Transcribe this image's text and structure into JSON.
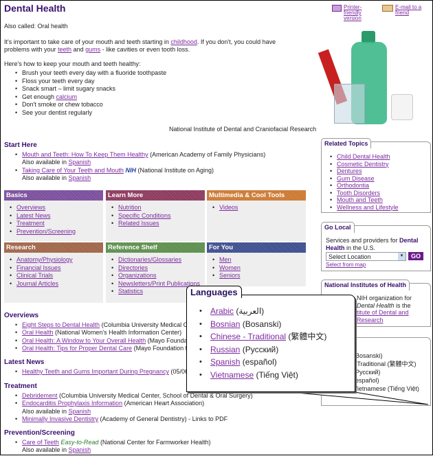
{
  "title": "Dental Health",
  "also_called": "Also called: Oral health",
  "intro": {
    "p1": "It's important to take care of your mouth and teeth starting in ",
    "l1": "childhood",
    "p2": ". If you don't, you could have problems with your ",
    "l2": "teeth",
    "p3": " and ",
    "l3": "gums",
    "p4": " - like cavities or even tooth loss."
  },
  "howto": "Here's how to keep your mouth and teeth healthy:",
  "tips": [
    "Brush your teeth every day with a fluoride toothpaste",
    "Floss your teeth every day",
    "Snack smart – limit sugary snacks",
    "Get enough ",
    "Don't smoke or chew tobacco",
    "See your dentist regularly"
  ],
  "tip_link": "calcium",
  "attribution": "National Institute of Dental and Craniofacial Research",
  "tools": {
    "print": "Printer-friendly version",
    "email": "E-mail to a friend"
  },
  "start_here": {
    "title": "Start Here",
    "items": [
      {
        "link": "Mouth and Teeth: How To Keep Them Healthy",
        "source": "(American Academy of Family Physicians)"
      },
      {
        "link": "Taking Care of Your Teeth and Mouth",
        "badge": "NIH",
        "source": "(National Institute on Aging)"
      }
    ],
    "also": "Also available in ",
    "spanish": "Spanish"
  },
  "boxes": [
    {
      "title": "Basics",
      "color": "#7b4f9d",
      "items": [
        "Overviews",
        "Latest News",
        "Treatment",
        "Prevention/Screening"
      ]
    },
    {
      "title": "Learn More",
      "color": "#8d3a5e",
      "items": [
        "Nutrition",
        "Specific Conditions",
        "Related Issues"
      ]
    },
    {
      "title": "Multimedia & Cool Tools",
      "color": "#cc7a33",
      "items": [
        "Videos"
      ]
    },
    {
      "title": "Research",
      "color": "#a0664a",
      "items": [
        "Anatomy/Physiology",
        "Financial Issues",
        "Clinical Trials",
        "Journal Articles"
      ]
    },
    {
      "title": "Reference Shelf",
      "color": "#5e8f4e",
      "items": [
        "Dictionaries/Glossaries",
        "Directories",
        "Organizations",
        "Newsletters/Print Publications",
        "Statistics"
      ]
    },
    {
      "title": "For You",
      "color": "#3f4f8f",
      "items": [
        "Men",
        "Women",
        "Seniors"
      ]
    }
  ],
  "overviews": {
    "title": "Overviews",
    "items": [
      {
        "link": "Eight Steps to Dental Health",
        "source": "(Columbia University Medical Center"
      },
      {
        "link": "Oral Health",
        "source": "(National Women's Health Information Center)"
      },
      {
        "link": "Oral Health: A Window to Your Overall Health",
        "source": "(Mayo Foundation fo"
      },
      {
        "link": "Oral Health: Tips for Proper Dental Care",
        "source": "(Mayo Foundation for Me"
      }
    ]
  },
  "latest_news": {
    "title": "Latest News",
    "items": [
      {
        "link": "Healthy Teeth and Gums Important During Pregnancy",
        "source": "(05/06/2008"
      }
    ]
  },
  "treatment": {
    "title": "Treatment",
    "items": [
      {
        "link": "Debridement",
        "source": "(Columbia University Medical Center, School of Dental & Oral Surgery)"
      },
      {
        "link": "Endocarditis Prophylaxis Information",
        "source": "(American Heart Association)"
      },
      {
        "link": "Minimally Invasive Dentistry",
        "source": "(Academy of General Dentistry) - Links to PDF"
      }
    ]
  },
  "prevention": {
    "title": "Prevention/Screening",
    "items": [
      {
        "link": "Care of Teeth",
        "tag": "Easy-to-Read",
        "source": "(National Center for Farmworker Health)"
      }
    ]
  },
  "related": {
    "title": "Related Topics",
    "items": [
      "Child Dental Health",
      "Cosmetic Dentistry",
      "Dentures",
      "Gum Disease",
      "Orthodontia",
      "Tooth Disorders",
      "Mouth and Teeth",
      "Wellness and Lifestyle"
    ]
  },
  "go_local": {
    "title": "Go Local",
    "t1": "Services and providers for ",
    "b": "Dental Health",
    "t2": " in the U.S.",
    "select": "Select Location",
    "go": "GO",
    "map": "Select from map"
  },
  "nih": {
    "title": "National Institutes of Health",
    "t1": "NIH organization for",
    "t2": "Dental Health",
    "t3": " is the",
    "l": "titute of Dental and",
    "l2": "Research"
  },
  "languages": {
    "title": "Languages",
    "items": [
      {
        "link": "Arabic",
        "native": "(العربية)"
      },
      {
        "link": "Bosnian",
        "native": "(Bosanski)"
      },
      {
        "link": "Chinese - Traditional",
        "native": "(繁體中文)"
      },
      {
        "link": "Russian",
        "native": "(Русский)"
      },
      {
        "link": "Spanish",
        "native": "(español)"
      },
      {
        "link": "Vietnamese",
        "native": "(Tiếng Việt)"
      }
    ]
  },
  "bg_languages": {
    "items": [
      "(Bosanski)",
      "- Traditional (繁體中文)",
      "(Русский)",
      "(español)",
      "Vietnamese (Tiếng Việt)"
    ]
  }
}
